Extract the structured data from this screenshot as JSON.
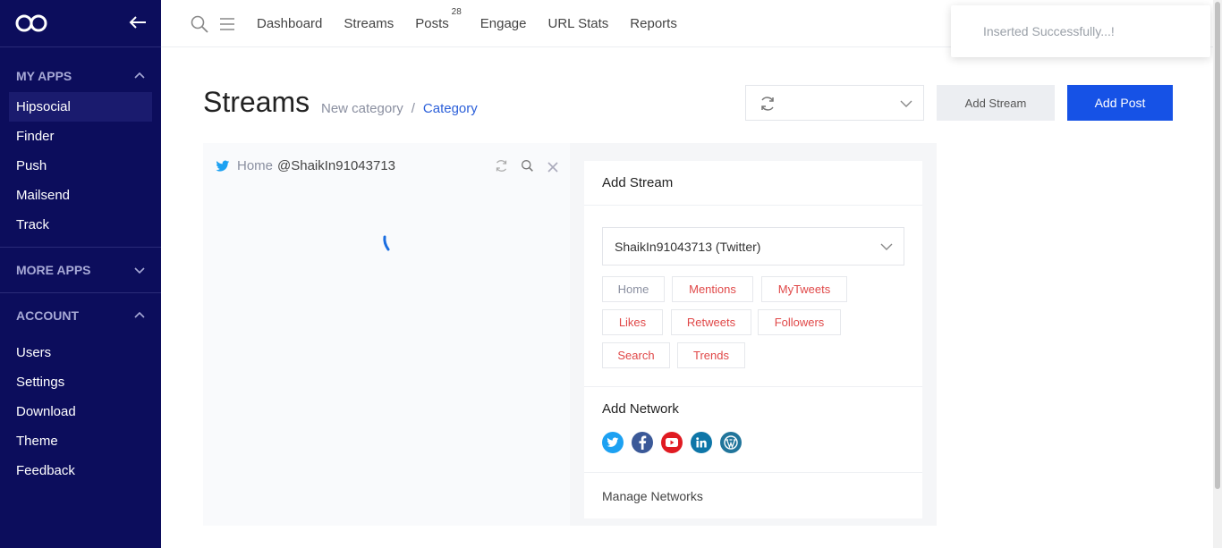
{
  "sidebar": {
    "sections": [
      {
        "title": "MY APPS",
        "expanded": true,
        "items": [
          "Hipsocial",
          "Finder",
          "Push",
          "Mailsend",
          "Track"
        ],
        "active": "Hipsocial"
      },
      {
        "title": "MORE APPS",
        "expanded": false,
        "items": []
      },
      {
        "title": "ACCOUNT",
        "expanded": true,
        "items": [
          "Users",
          "Settings",
          "Download",
          "Theme",
          "Feedback"
        ]
      }
    ]
  },
  "topnav": {
    "links": [
      "Dashboard",
      "Streams",
      "Posts",
      "Engage",
      "URL Stats",
      "Reports"
    ],
    "posts_badge": "28"
  },
  "toast": {
    "message": "Inserted Successfully...!"
  },
  "page": {
    "title": "Streams",
    "breadcrumb": {
      "first": "New category",
      "separator": "/",
      "current": "Category"
    },
    "add_stream_label": "Add Stream",
    "add_post_label": "Add Post"
  },
  "stream": {
    "label": "Home",
    "account": "@ShaikIn91043713"
  },
  "add_stream": {
    "title": "Add Stream",
    "account_select": "ShaikIn91043713 (Twitter)",
    "tags": [
      "Home",
      "Mentions",
      "MyTweets",
      "Likes",
      "Retweets",
      "Followers",
      "Search",
      "Trends"
    ],
    "add_network_title": "Add Network",
    "networks": [
      "twitter-icon",
      "facebook-icon",
      "youtube-icon",
      "linkedin-icon",
      "wordpress-icon"
    ],
    "manage_label": "Manage Networks"
  },
  "colors": {
    "sidebar": "#0c0d5c",
    "primary": "#1652e6",
    "tag_text": "#e04848"
  }
}
